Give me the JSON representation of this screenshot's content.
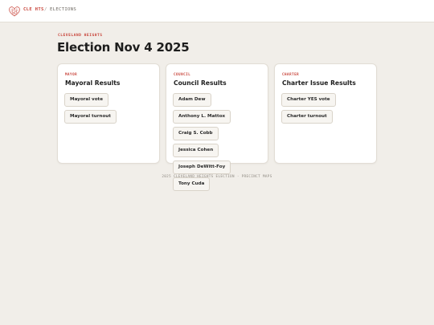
{
  "header": {
    "brand": "CLE HTS",
    "separator": "/",
    "crumb": "ELECTIONS"
  },
  "page": {
    "eyebrow": "CLEVELAND HEIGHTS",
    "title": "Election Nov 4 2025"
  },
  "cards": [
    {
      "eyebrow": "MAYOR",
      "title": "Mayoral Results",
      "chips": [
        "Mayoral vote",
        "Mayoral turnout"
      ]
    },
    {
      "eyebrow": "COUNCIL",
      "title": "Council Results",
      "chips": [
        "Adam Dew",
        "Anthony L. Mattox",
        "Craig S. Cobb",
        "Jessica Cohen",
        "Joseph DeWitt-Foy",
        "Tony Cuda"
      ]
    },
    {
      "eyebrow": "CHARTER",
      "title": "Charter Issue Results",
      "chips": [
        "Charter YES vote",
        "Charter turnout"
      ]
    }
  ],
  "footer": "2025 CLEVELAND HEIGHTS ELECTION · PRECINCT MAPS",
  "colors": {
    "accent": "#c8443a",
    "background": "#f1eee9",
    "card": "#ffffff"
  },
  "icons": {
    "logo": "heart-map-icon"
  }
}
